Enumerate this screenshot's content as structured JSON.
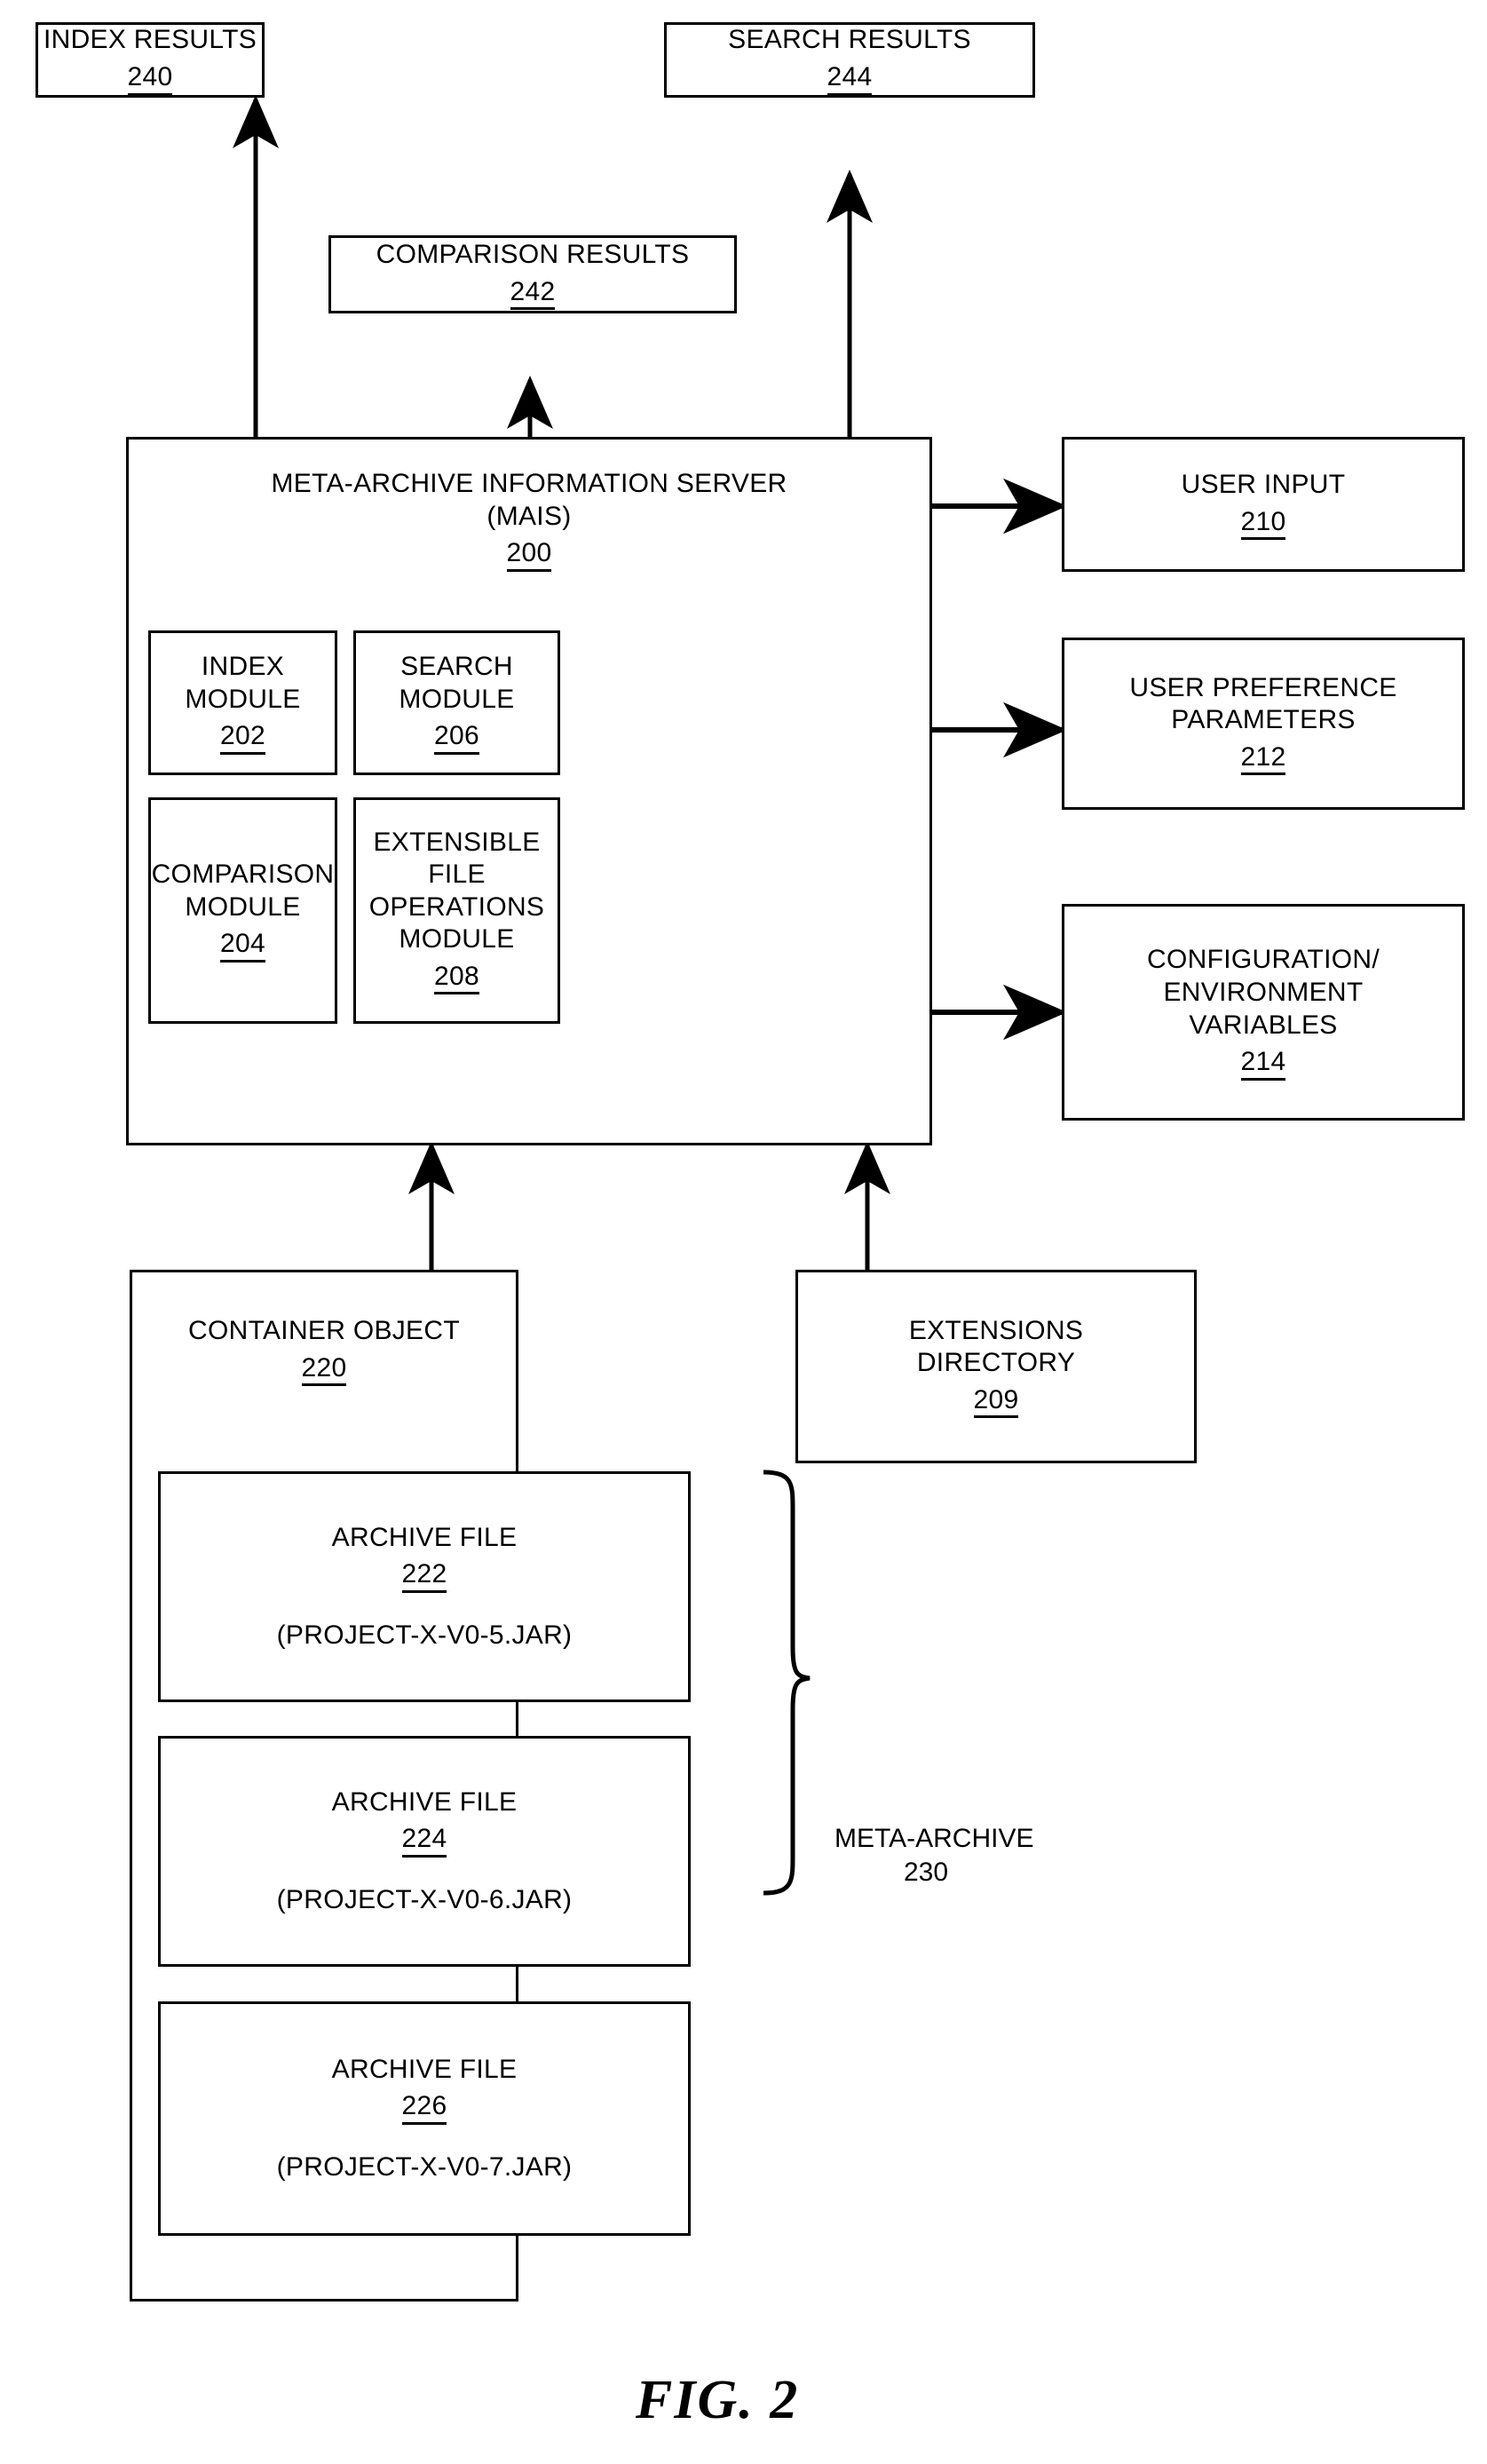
{
  "figure": {
    "caption": "FIG. 2"
  },
  "boxes": {
    "index_results": {
      "title": "INDEX RESULTS",
      "ref": "240"
    },
    "search_results": {
      "title": "SEARCH RESULTS",
      "ref": "244"
    },
    "comparison_results": {
      "title": "COMPARISON RESULTS",
      "ref": "242"
    },
    "mais": {
      "title": "META-ARCHIVE INFORMATION SERVER\n(MAIS)",
      "ref": "200"
    },
    "index_module": {
      "title": "INDEX MODULE",
      "ref": "202"
    },
    "search_module": {
      "title": "SEARCH MODULE",
      "ref": "206"
    },
    "comparison_module": {
      "title": "COMPARISON\nMODULE",
      "ref": "204"
    },
    "extensible_file_operations_module": {
      "title": "EXTENSIBLE FILE\nOPERATIONS\nMODULE",
      "ref": "208"
    },
    "user_input": {
      "title": "USER INPUT",
      "ref": "210"
    },
    "user_preference_parameters": {
      "title": "USER PREFERENCE\nPARAMETERS",
      "ref": "212"
    },
    "configuration_environment_variables": {
      "title": "CONFIGURATION/\nENVIRONMENT\nVARIABLES",
      "ref": "214"
    },
    "container_object": {
      "title": "CONTAINER OBJECT",
      "ref": "220"
    },
    "extensions_directory": {
      "title": "EXTENSIONS\nDIRECTORY",
      "ref": "209"
    },
    "archive_file_222": {
      "title": "ARCHIVE FILE",
      "ref": "222",
      "filename": "(PROJECT-X-V0-5.JAR)"
    },
    "archive_file_224": {
      "title": "ARCHIVE FILE",
      "ref": "224",
      "filename": "(PROJECT-X-V0-6.JAR)"
    },
    "archive_file_226": {
      "title": "ARCHIVE FILE",
      "ref": "226",
      "filename": "(PROJECT-X-V0-7.JAR)"
    }
  },
  "annotations": {
    "meta_archive": {
      "title": "META-ARCHIVE",
      "ref": "230"
    }
  },
  "colors": {
    "stroke": "#000000",
    "background": "#ffffff"
  }
}
